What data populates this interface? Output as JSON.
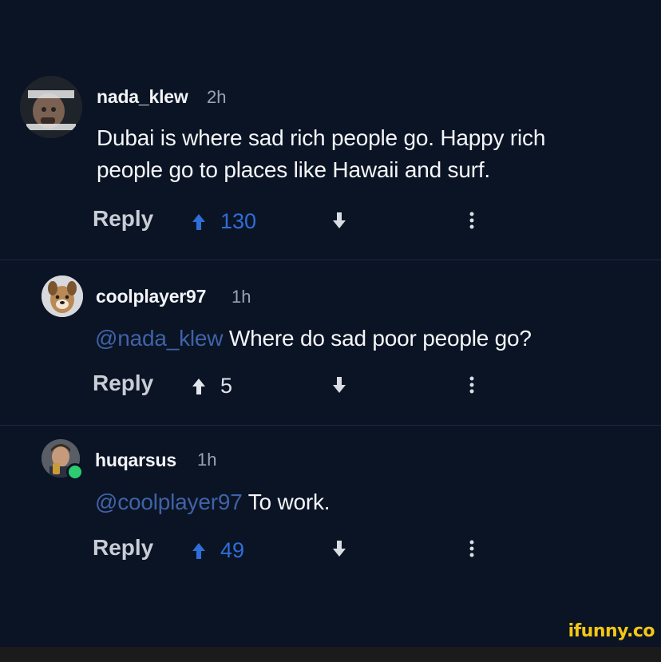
{
  "comments": [
    {
      "username": "nada_klew",
      "time": "2h",
      "mention": "",
      "text_line1": "Dubai is where sad rich people go. Happy rich",
      "text_line2": "people go to places like Hawaii and surf.",
      "reply_label": "Reply",
      "score": "130",
      "score_highlight": true,
      "avatar_icon": "movie-poster-avatar"
    },
    {
      "username": "coolplayer97",
      "time": "1h",
      "mention": "@nada_klew",
      "text": "Where do sad poor people go?",
      "reply_label": "Reply",
      "score": "5",
      "score_highlight": false,
      "avatar_icon": "dog-avatar"
    },
    {
      "username": "huqarsus",
      "time": "1h",
      "mention": "@coolplayer97",
      "text": "To work.",
      "reply_label": "Reply",
      "score": "49",
      "score_highlight": true,
      "avatar_icon": "man-avatar",
      "online_badge": true
    }
  ],
  "watermark": "ifunny.co",
  "colors": {
    "background": "#0b1424",
    "mention": "#3f62a8",
    "upvoted": "#2f6ed8",
    "online": "#2ecc71",
    "watermark": "#f3c617"
  }
}
